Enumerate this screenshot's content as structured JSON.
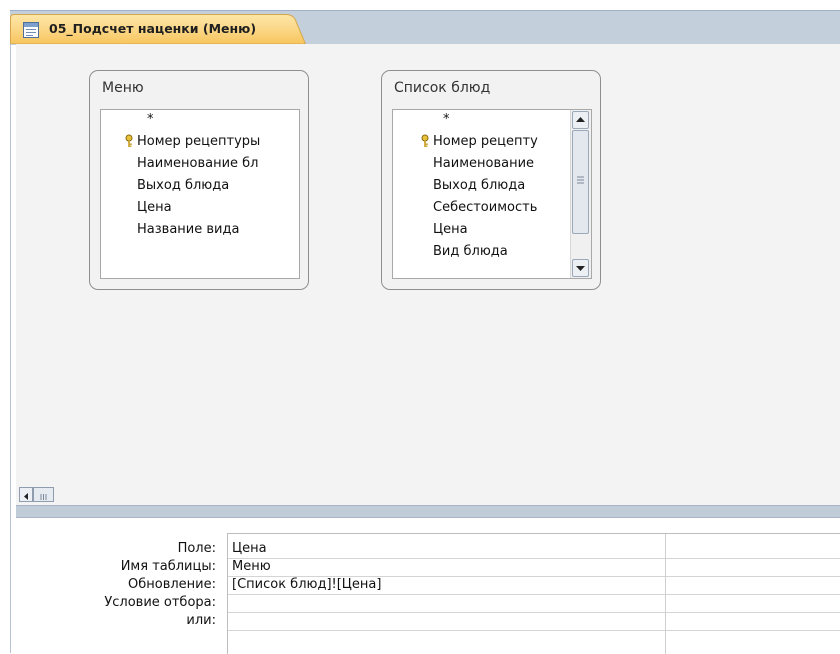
{
  "tab": {
    "title": "05_Подсчет наценки (Меню)",
    "icon": "query-design-icon"
  },
  "tables": [
    {
      "title": "Меню",
      "fields": [
        {
          "label": "*",
          "key": false
        },
        {
          "label": "Номер рецептуры",
          "key": true
        },
        {
          "label": "Наименование бл",
          "key": false
        },
        {
          "label": "Выход блюда",
          "key": false
        },
        {
          "label": "Цена",
          "key": false
        },
        {
          "label": "Название вида",
          "key": false
        }
      ]
    },
    {
      "title": "Список блюд",
      "fields": [
        {
          "label": "*",
          "key": false
        },
        {
          "label": "Номер рецепту",
          "key": true
        },
        {
          "label": "Наименование",
          "key": false
        },
        {
          "label": "Выход блюда",
          "key": false
        },
        {
          "label": "Себестоимость",
          "key": false
        },
        {
          "label": "Цена",
          "key": false
        },
        {
          "label": "Вид блюда",
          "key": false
        }
      ]
    }
  ],
  "grid": {
    "row_labels": [
      "Поле:",
      "Имя таблицы:",
      "Обновление:",
      "Условие отбора:",
      "или:"
    ],
    "columns": [
      {
        "values": [
          "Цена",
          "Меню",
          "[Список блюд]![Цена]",
          "",
          ""
        ]
      },
      {
        "values": [
          "",
          "",
          "",
          "",
          ""
        ]
      }
    ]
  },
  "colors": {
    "tab_fill": "#fbd787",
    "tab_border": "#d6a64a",
    "tab_bar": "#c4cfdc"
  }
}
